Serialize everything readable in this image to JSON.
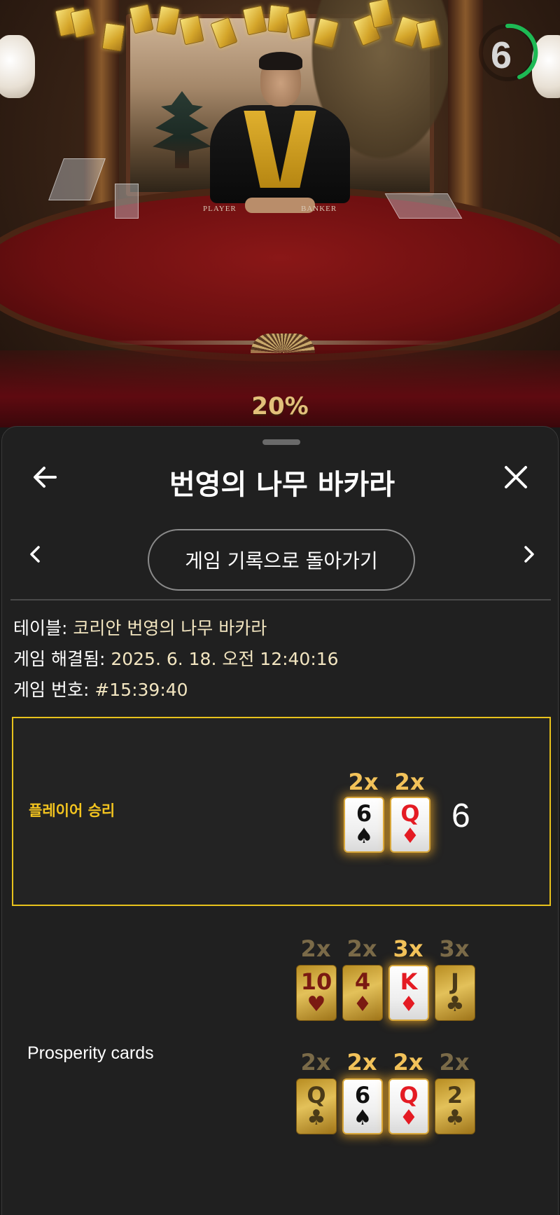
{
  "video": {
    "table_labels": [
      "PLAYER",
      "BANKER"
    ],
    "countdown": "6",
    "percent": "20%"
  },
  "header": {
    "title": "번영의 나무 바카라",
    "back_icon": "arrow-left-icon",
    "close_icon": "close-icon"
  },
  "nav": {
    "back_to_history_label": "게임 기록으로 돌아가기",
    "prev_icon": "chevron-left-icon",
    "next_icon": "chevron-right-icon"
  },
  "info": {
    "table_label": "테이블:",
    "table_value": "코리안 번영의 나무 바카라",
    "resolved_label": "게임 해결됨:",
    "resolved_value": "2025. 6. 18. 오전 12:40:16",
    "game_no_label": "게임 번호:",
    "game_no_value": "#15:39:40"
  },
  "result": {
    "label": "플레이어 승리",
    "score": "6",
    "cards": [
      {
        "multiplier": "2x",
        "rank": "6",
        "suit": "♠",
        "color": "black"
      },
      {
        "multiplier": "2x",
        "rank": "Q",
        "suit": "♦",
        "color": "red"
      }
    ]
  },
  "prosperity": {
    "label": "Prosperity cards",
    "rows": [
      [
        {
          "multiplier": "2x",
          "rank": "10",
          "suit": "♥",
          "color": "red",
          "active": false
        },
        {
          "multiplier": "2x",
          "rank": "4",
          "suit": "♦",
          "color": "red",
          "active": false
        },
        {
          "multiplier": "3x",
          "rank": "K",
          "suit": "♦",
          "color": "red",
          "active": true
        },
        {
          "multiplier": "3x",
          "rank": "J",
          "suit": "♣",
          "color": "black",
          "active": false
        }
      ],
      [
        {
          "multiplier": "2x",
          "rank": "Q",
          "suit": "♣",
          "color": "black",
          "active": false
        },
        {
          "multiplier": "2x",
          "rank": "6",
          "suit": "♠",
          "color": "black",
          "active": true
        },
        {
          "multiplier": "2x",
          "rank": "Q",
          "suit": "♦",
          "color": "red",
          "active": true
        },
        {
          "multiplier": "2x",
          "rank": "2",
          "suit": "♣",
          "color": "black",
          "active": false
        }
      ]
    ]
  },
  "colors": {
    "accent_gold": "#f3c41f",
    "timer_green": "#1db954",
    "sheet_bg": "#202020"
  }
}
